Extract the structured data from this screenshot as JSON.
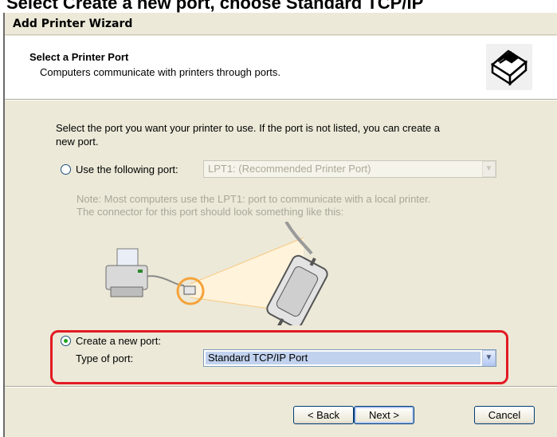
{
  "caption": "Select Create a new port, choose Standard TCP/IP",
  "window": {
    "title": "Add Printer Wizard"
  },
  "header": {
    "title": "Select a Printer Port",
    "subtitle": "Computers communicate with printers through ports."
  },
  "body": {
    "intro_line1": "Select the port you want your printer to use.  If the port is not listed, you can create a",
    "intro_line2": "new port.",
    "use_port": {
      "label": "Use the following port:",
      "selected": false,
      "combo_value": "LPT1: (Recommended Printer Port)",
      "enabled": false
    },
    "note_line1": "Note: Most computers use the LPT1: port to communicate with a local printer.",
    "note_line2": "The connector for this port should look something like this:",
    "create_port": {
      "label": "Create a new port:",
      "selected": true
    },
    "type_of_port": {
      "label": "Type of port:",
      "value": "Standard TCP/IP Port"
    }
  },
  "buttons": {
    "back": "< Back",
    "next": "Next >",
    "cancel": "Cancel"
  },
  "colors": {
    "highlight": "#e21a23",
    "dialog_bg": "#ece9d8",
    "radio_dot": "#21a121"
  }
}
